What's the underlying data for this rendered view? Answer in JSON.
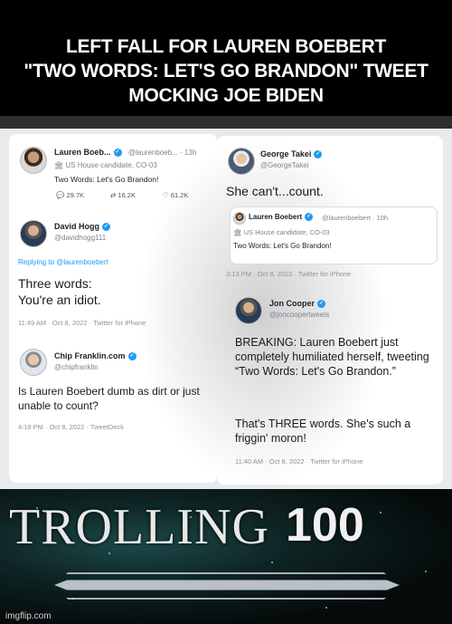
{
  "header": {
    "line1": "LEFT FALL FOR LAUREN BOEBERT",
    "line2": "\"TWO WORDS: LET'S GO BRANDON\" TWEET",
    "line3": "MOCKING JOE BIDEN"
  },
  "tweets": {
    "boebert": {
      "name": "Lauren Boeb...",
      "handle": "@laurenboeb... · 13h",
      "candidate": "US House candidate, CO-03",
      "text": "Two Words: Let's Go Brandon!",
      "replies": "29.7K",
      "retweets": "16.2K",
      "likes": "61.2K"
    },
    "hogg": {
      "name": "David Hogg",
      "handle": "@davidhogg111",
      "replying": "Replying to @laurenboebert",
      "text_line1": "Three words:",
      "text_line2": "You're an idiot.",
      "meta": "11:49 AM · Oct 8, 2022 · Twitter for iPhone"
    },
    "franklin": {
      "name": "Chip Franklin.com",
      "handle": "@chipfranklin",
      "text": "Is Lauren Boebert dumb as dirt or just unable to count?",
      "meta": "4:18 PM · Oct 8, 2022 · TweetDeck"
    },
    "takei": {
      "name": "George Takei",
      "handle": "@GeorgeTakei",
      "text": "She can't...count.",
      "meta": "3:13 PM · Oct 8, 2022 · Twitter for iPhone"
    },
    "quoted": {
      "name": "Lauren Boebert",
      "handle": "@laurenboebert · 10h",
      "candidate": "US House candidate, CO-03",
      "text": "Two Words: Let's Go Brandon!"
    },
    "cooper": {
      "name": "Jon Cooper",
      "handle": "@joncoopertweets",
      "text1": "BREAKING: Lauren Boebert just completely humiliated herself, tweeting “Two Words: Let's Go Brandon.”",
      "text2": "That's THREE words. She's such a friggin' moron!",
      "meta": "11:40 AM · Oct 8, 2022 · Twitter for iPhone"
    }
  },
  "bottom": {
    "word": "TROLLING",
    "number": "100",
    "progress_fraction": 1.0
  },
  "watermark": "imgflip.com",
  "colors": {
    "verified": "#1d9bf0",
    "header_bg": "#000000"
  }
}
